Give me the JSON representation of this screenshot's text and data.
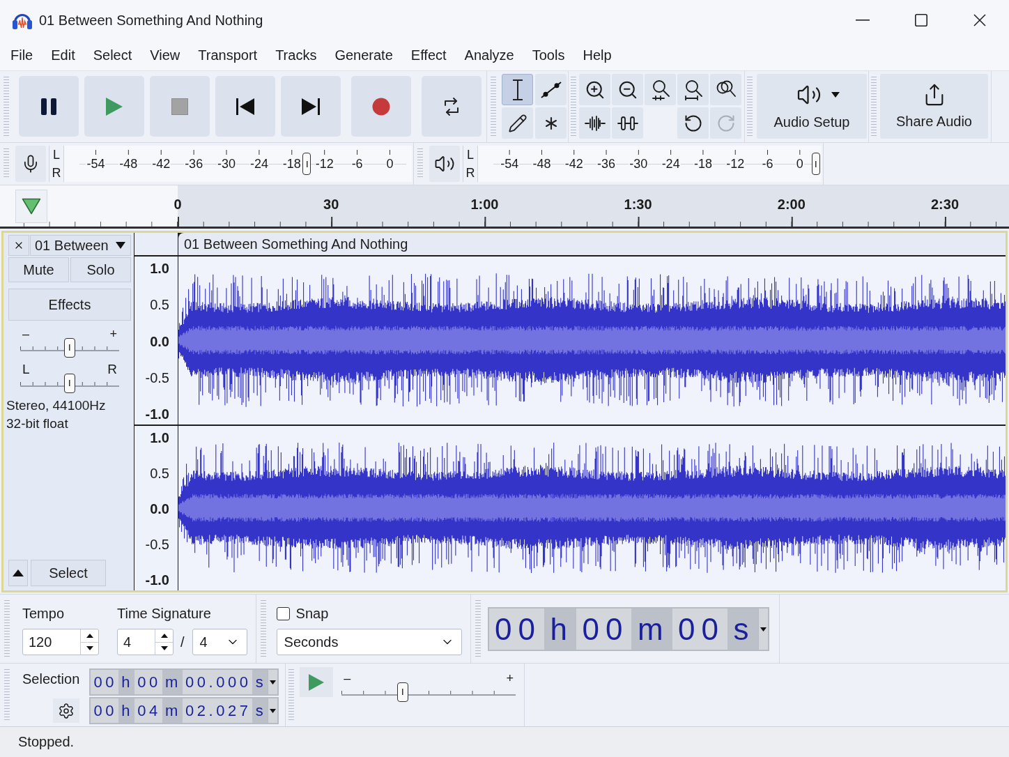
{
  "window": {
    "title": "01 Between Something And Nothing"
  },
  "menu_bar": [
    "File",
    "Edit",
    "Select",
    "View",
    "Transport",
    "Tracks",
    "Generate",
    "Effect",
    "Analyze",
    "Tools",
    "Help"
  ],
  "transport_toolbar": [
    {
      "kind": "pause"
    },
    {
      "kind": "play"
    },
    {
      "kind": "stop"
    },
    {
      "kind": "skip_start"
    },
    {
      "kind": "skip_end"
    },
    {
      "kind": "record"
    },
    {
      "kind": "loop"
    }
  ],
  "tools_toolbar": [
    {
      "kind": "select",
      "selected": true
    },
    {
      "kind": "envelope",
      "selected": false
    },
    {
      "kind": "draw",
      "selected": false
    },
    {
      "kind": "multi",
      "selected": false
    }
  ],
  "edit_toolbar": [
    {
      "kind": "zoom_in",
      "disabled": false
    },
    {
      "kind": "zoom_out",
      "disabled": false
    },
    {
      "kind": "fit_selection",
      "disabled": false
    },
    {
      "kind": "fit_project",
      "disabled": false
    },
    {
      "kind": "zoom_toggle",
      "disabled": false
    },
    {
      "kind": "trim",
      "disabled": false
    },
    {
      "kind": "silence",
      "disabled": false
    },
    {
      "kind": "undo",
      "disabled": false
    },
    {
      "kind": "redo",
      "disabled": true
    }
  ],
  "audio_setup": {
    "label": "Audio Setup"
  },
  "share_audio": {
    "label": "Share Audio"
  },
  "recording_meter": {
    "channels": [
      "L",
      "R"
    ],
    "scale": [
      "-54",
      "-48",
      "-42",
      "-36",
      "-30",
      "-24",
      "-18",
      "-12",
      "-6",
      "0"
    ],
    "level": 0.68
  },
  "playback_meter": {
    "channels": [
      "L",
      "R"
    ],
    "scale": [
      "-54",
      "-48",
      "-42",
      "-36",
      "-30",
      "-24",
      "-18",
      "-12",
      "-6",
      "0"
    ],
    "level": 1
  },
  "timeline": {
    "labels": [
      "0",
      "30",
      "1:00",
      "1:30",
      "2:00",
      "2:30"
    ]
  },
  "track": {
    "name": "01 Between",
    "mute": {
      "label": "Mute",
      "on": false
    },
    "solo": {
      "label": "Solo",
      "on": false
    },
    "effects": "Effects",
    "gain": {
      "minus": "–",
      "plus": "+",
      "level": 0.5
    },
    "pan": {
      "left": "L",
      "right": "R",
      "level": 0.5
    },
    "format": [
      "Stereo, 44100Hz",
      "32-bit float"
    ],
    "select": "Select",
    "clip_title": "01 Between Something And Nothing",
    "channels": [
      {
        "scale": [
          "1.0",
          "0.5",
          "0.0",
          "-0.5",
          "-1.0"
        ]
      },
      {
        "scale": [
          "1.0",
          "0.5",
          "0.0",
          "-0.5",
          "-1.0"
        ]
      }
    ]
  },
  "time_signature": {
    "tempo_label": "Tempo",
    "tempo": "120",
    "label": "Time Signature",
    "beats": "4",
    "separator": "/",
    "note_value": "4"
  },
  "snap": {
    "label": "Snap",
    "checked": false,
    "unit": "Seconds"
  },
  "time_display": {
    "value": "00 h 00 m 00 s"
  },
  "selection": {
    "label": "Selection",
    "start": "00 h 00 m 00.000 s",
    "end": "00 h 04 m 02.027 s"
  },
  "play_at_speed": {
    "minus": "–",
    "plus": "+",
    "level": 0.35
  },
  "status_bar": {
    "text": "Stopped."
  }
}
